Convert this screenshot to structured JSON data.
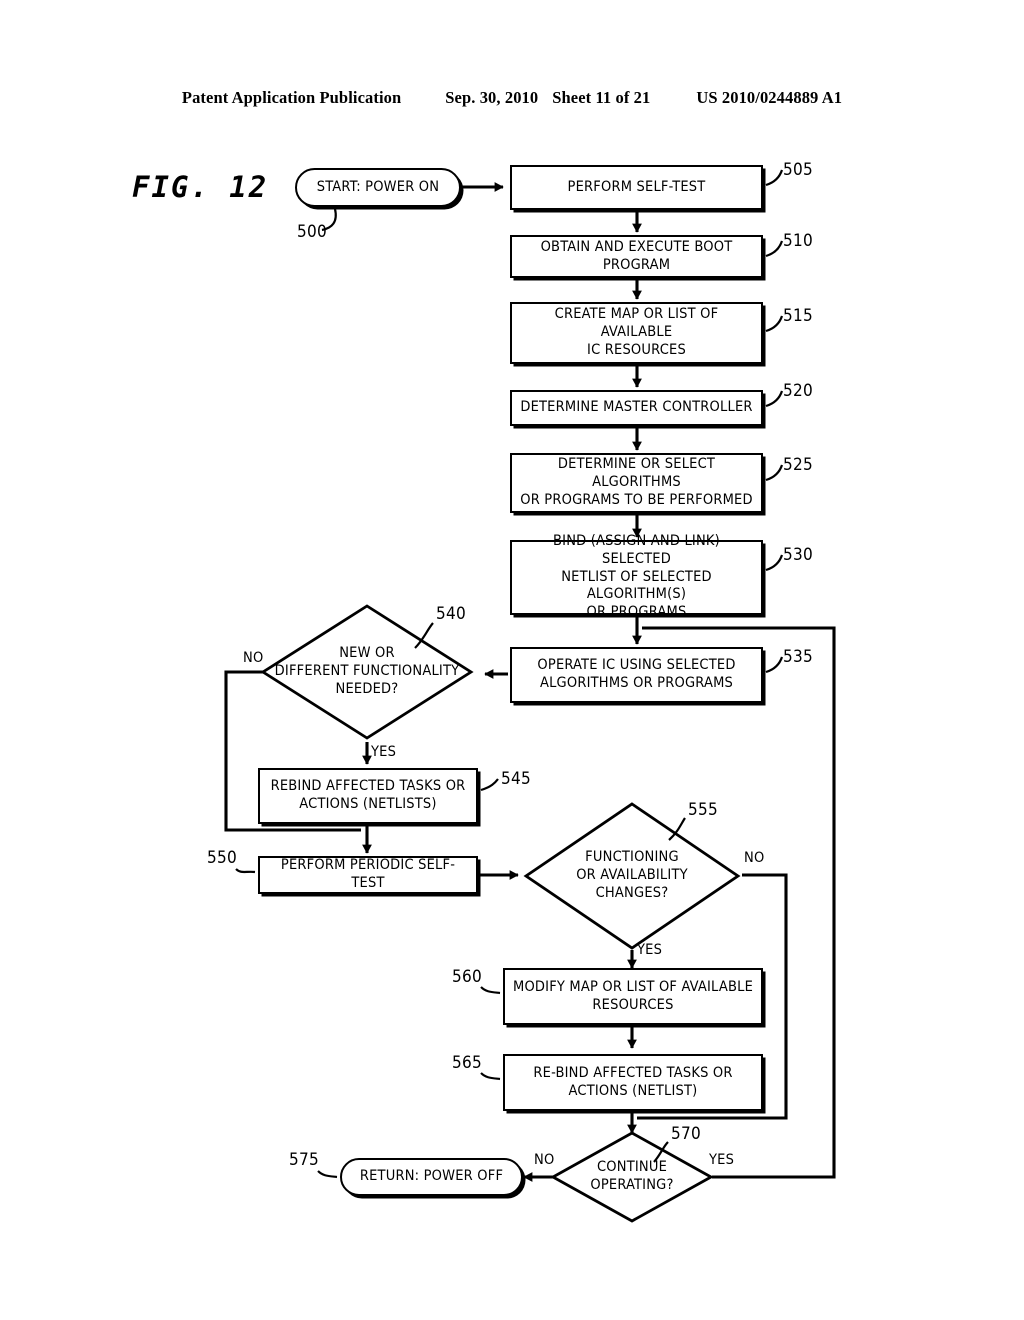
{
  "header": {
    "publication": "Patent Application Publication",
    "date": "Sep. 30, 2010",
    "sheet": "Sheet 11 of 21",
    "patent_number": "US 2010/0244889 A1"
  },
  "figure": {
    "label": "FIG. 12"
  },
  "flowchart": {
    "nodes": [
      {
        "id": "500",
        "ref": "500",
        "type": "terminator",
        "text": "START: POWER ON"
      },
      {
        "id": "505",
        "ref": "505",
        "type": "process",
        "text": "PERFORM SELF-TEST"
      },
      {
        "id": "510",
        "ref": "510",
        "type": "process",
        "text": "OBTAIN AND EXECUTE BOOT PROGRAM"
      },
      {
        "id": "515",
        "ref": "515",
        "type": "process",
        "text": "CREATE MAP OR LIST OF AVAILABLE\nIC RESOURCES"
      },
      {
        "id": "520",
        "ref": "520",
        "type": "process",
        "text": "DETERMINE MASTER CONTROLLER"
      },
      {
        "id": "525",
        "ref": "525",
        "type": "process",
        "text": "DETERMINE OR SELECT ALGORITHMS\nOR PROGRAMS TO BE PERFORMED"
      },
      {
        "id": "530",
        "ref": "530",
        "type": "process",
        "text": "BIND (ASSIGN AND LINK) SELECTED\nNETLIST OF SELECTED ALGORITHM(S)\nOR PROGRAMS"
      },
      {
        "id": "535",
        "ref": "535",
        "type": "process",
        "text": "OPERATE IC USING SELECTED\nALGORITHMS OR PROGRAMS"
      },
      {
        "id": "540",
        "ref": "540",
        "type": "decision",
        "text": "NEW OR\nDIFFERENT FUNCTIONALITY\nNEEDED?"
      },
      {
        "id": "545",
        "ref": "545",
        "type": "process",
        "text": "REBIND AFFECTED TASKS OR\nACTIONS (NETLISTS)"
      },
      {
        "id": "550",
        "ref": "550",
        "type": "process",
        "text": "PERFORM PERIODIC SELF-TEST"
      },
      {
        "id": "555",
        "ref": "555",
        "type": "decision",
        "text": "FUNCTIONING\nOR AVAILABILITY\nCHANGES?"
      },
      {
        "id": "560",
        "ref": "560",
        "type": "process",
        "text": "MODIFY MAP OR LIST OF AVAILABLE\nRESOURCES"
      },
      {
        "id": "565",
        "ref": "565",
        "type": "process",
        "text": "RE-BIND AFFECTED TASKS OR\nACTIONS (NETLIST)"
      },
      {
        "id": "570",
        "ref": "570",
        "type": "decision",
        "text": "CONTINUE\nOPERATING?"
      },
      {
        "id": "575",
        "ref": "575",
        "type": "terminator",
        "text": "RETURN: POWER OFF"
      }
    ],
    "branch_labels": {
      "d540_no": "NO",
      "d540_yes": "YES",
      "d555_no": "NO",
      "d555_yes": "YES",
      "d570_no": "NO",
      "d570_yes": "YES"
    }
  },
  "colors": {
    "ink": "#000000",
    "paper": "#ffffff"
  }
}
